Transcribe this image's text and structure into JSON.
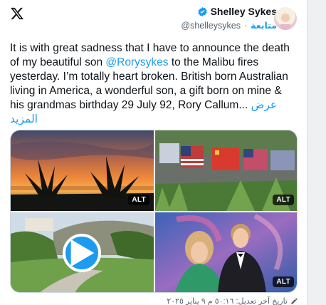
{
  "header": {
    "logo": "x-logo-icon",
    "author_name": "Shelley Sykes",
    "follow_label": "متابعة",
    "separator": "·",
    "handle": "@shelleysykes",
    "verified_icon": "verified-badge-icon"
  },
  "tweet": {
    "text_part1": "It is with great sadness that I have to announce the death of my beautiful son ",
    "mention": "@Rorysykes",
    "text_part2": " to the Malibu fires yesterday. I’m totally heart broken. British born Australian living in America, a wonderful son, a gift born on mine & his grandmas birthday 29 July 92, Rory Callum...",
    "show_more": "عرض المزيد"
  },
  "media": {
    "alt_label": "ALT",
    "tiles": [
      {
        "kind": "image",
        "subject": "sunset-agave-silhouette"
      },
      {
        "kind": "image",
        "subject": "flags-by-hedge"
      },
      {
        "kind": "video",
        "subject": "garden-lawn-path"
      },
      {
        "kind": "image",
        "subject": "mother-and-son-portrait"
      }
    ],
    "accent": "#1d9bf0"
  },
  "footer": {
    "edited_text": "تاريخ آخر تعديل: ٥٠:١٦ م ٩ يناير ٢٠٢٥"
  },
  "colors": {
    "text": "#0f1419",
    "muted": "#536471",
    "link": "#1d9bf0",
    "border": "#cfd9de"
  }
}
